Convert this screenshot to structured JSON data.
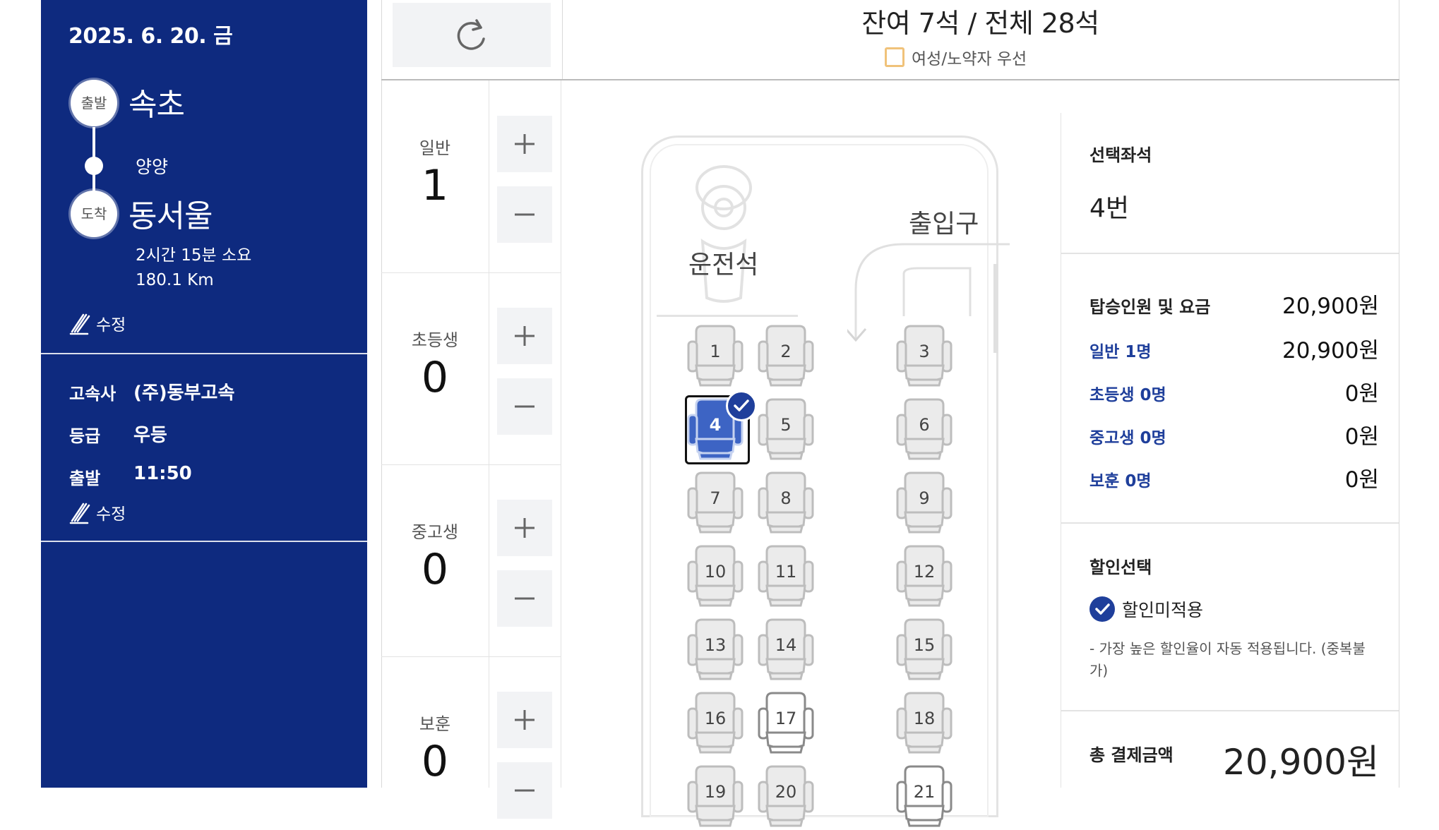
{
  "trip": {
    "date": "2025. 6. 20. 금",
    "depart_badge": "출발",
    "depart_city": "속초",
    "via": "양양",
    "arrive_badge": "도착",
    "arrive_city": "동서울",
    "duration": "2시간 15분 소요",
    "distance": "180.1 Km",
    "edit_label": "수정"
  },
  "bus_info": {
    "company_key": "고속사",
    "company_val": "(주)동부고속",
    "grade_key": "등급",
    "grade_val": "우등",
    "depart_key": "출발",
    "depart_val": "11:50",
    "edit_label": "수정"
  },
  "header": {
    "remaining": "잔여 7석 / 전체 28석",
    "priority_label": "여성/노약자 우선"
  },
  "counters": [
    {
      "label": "일반",
      "count": "1"
    },
    {
      "label": "초등생",
      "count": "0"
    },
    {
      "label": "중고생",
      "count": "0"
    },
    {
      "label": "보훈",
      "count": "0"
    }
  ],
  "bus": {
    "driver_label": "운전석",
    "door_label": "출입구",
    "seats": [
      {
        "n": "1",
        "state": "sold"
      },
      {
        "n": "2",
        "state": "sold"
      },
      {
        "n": "3",
        "state": "sold"
      },
      {
        "n": "4",
        "state": "selected"
      },
      {
        "n": "5",
        "state": "sold"
      },
      {
        "n": "6",
        "state": "sold"
      },
      {
        "n": "7",
        "state": "sold"
      },
      {
        "n": "8",
        "state": "sold"
      },
      {
        "n": "9",
        "state": "sold"
      },
      {
        "n": "10",
        "state": "sold"
      },
      {
        "n": "11",
        "state": "sold"
      },
      {
        "n": "12",
        "state": "sold"
      },
      {
        "n": "13",
        "state": "sold"
      },
      {
        "n": "14",
        "state": "sold"
      },
      {
        "n": "15",
        "state": "sold"
      },
      {
        "n": "16",
        "state": "sold"
      },
      {
        "n": "17",
        "state": "available"
      },
      {
        "n": "18",
        "state": "sold"
      },
      {
        "n": "19",
        "state": "sold"
      },
      {
        "n": "20",
        "state": "sold"
      },
      {
        "n": "21",
        "state": "available"
      }
    ]
  },
  "summary": {
    "selected_title": "선택좌석",
    "selected_seat": "4번",
    "fare_title": "탑승인원 및 요금",
    "fare_total": "20,900원",
    "rows": [
      {
        "label": "일반 1명",
        "amount": "20,900원"
      },
      {
        "label": "초등생 0명",
        "amount": "0원"
      },
      {
        "label": "중고생 0명",
        "amount": "0원"
      },
      {
        "label": "보훈 0명",
        "amount": "0원"
      }
    ],
    "discount_title": "할인선택",
    "discount_option": "할인미적용",
    "discount_note": "- 가장 높은 할인율이 자동 적용됩니다. (중복불가)",
    "total_label": "총 결제금액",
    "total_amount": "20,900원"
  },
  "colors": {
    "panel": "#0e2a7f",
    "accent": "#1f3f9b",
    "priority_box": "#f0c27a"
  }
}
